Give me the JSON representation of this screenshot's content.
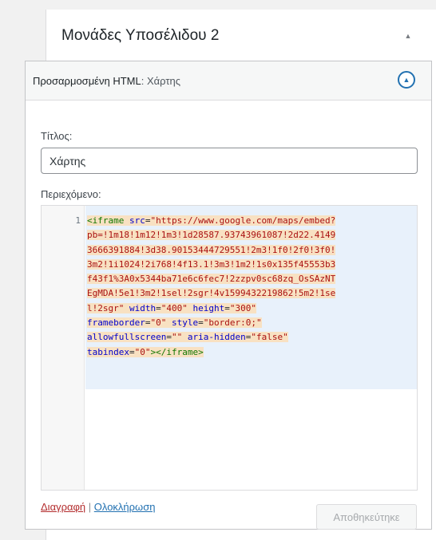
{
  "area": {
    "title": "Μονάδες Υποσέλιδου 2",
    "toggle_icon": "▲"
  },
  "widget": {
    "title_prefix": "Προσαρμοσμένη HTML",
    "title_suffix": ": Χάρτης",
    "toggle_icon": "▲"
  },
  "form": {
    "title_label": "Τίτλος:",
    "title_value": "Χάρτης",
    "content_label": "Περιεχόμενο:"
  },
  "editor": {
    "line_number": "1",
    "lines": [
      [
        [
          "tag",
          "<iframe "
        ],
        [
          "attr",
          "src"
        ],
        [
          "",
          "="
        ],
        [
          "str",
          "\"https://www.google.com/maps/embed?"
        ]
      ],
      [
        [
          "str",
          "pb=!1m18!1m12!1m3!1d28587.93743961087!2d22.4149"
        ]
      ],
      [
        [
          "str",
          "3666391884!3d38.90153444729551!2m3!1f0!2f0!3f0!"
        ]
      ],
      [
        [
          "str",
          "3m2!1i1024!2i768!4f13.1!3m3!1m2!1s0x135f45553b3"
        ]
      ],
      [
        [
          "str",
          "f43f1%3A0x5344ba71e6c6fec7!2zzpv0sc68zq_OsSAzNT"
        ]
      ],
      [
        [
          "str",
          "EgMDA!5e1!3m2!1sel!2sgr!4v1599432219862!5m2!1se"
        ]
      ],
      [
        [
          "str",
          "l!2sgr\""
        ],
        [
          "",
          " "
        ],
        [
          "attr",
          "width"
        ],
        [
          "",
          "="
        ],
        [
          "str",
          "\"400\""
        ],
        [
          "",
          " "
        ],
        [
          "attr",
          "height"
        ],
        [
          "",
          "="
        ],
        [
          "str",
          "\"300\""
        ]
      ],
      [
        [
          "attr",
          "frameborder"
        ],
        [
          "",
          "="
        ],
        [
          "str",
          "\"0\""
        ],
        [
          "",
          " "
        ],
        [
          "attr",
          "style"
        ],
        [
          "",
          "="
        ],
        [
          "str",
          "\"border:0;\""
        ]
      ],
      [
        [
          "attr",
          "allowfullscreen"
        ],
        [
          "",
          "="
        ],
        [
          "str",
          "\"\""
        ],
        [
          "",
          " "
        ],
        [
          "attr",
          "aria-hidden"
        ],
        [
          "",
          "="
        ],
        [
          "str",
          "\"false\""
        ]
      ],
      [
        [
          "attr",
          "tabindex"
        ],
        [
          "",
          "="
        ],
        [
          "str",
          "\"0\""
        ],
        [
          "tag",
          "></iframe>"
        ]
      ]
    ]
  },
  "footer": {
    "delete_label": "Διαγραφή",
    "separator": " | ",
    "done_label": "Ολοκλήρωση",
    "save_label": "Αποθηκεύτηκε"
  }
}
